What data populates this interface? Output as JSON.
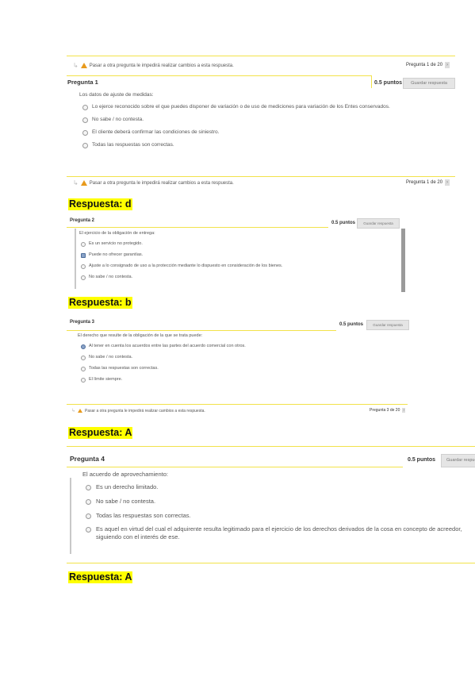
{
  "nav_notice": "Pasar a otra pregunta le impedirá realizar cambios a esta respuesta.",
  "save_label": "Guardar respuesta",
  "points_label": "0.5 puntos",
  "questions": [
    {
      "title": "Pregunta 1",
      "pager": "Pregunta 1 de 20",
      "text": "Los datos de ajuste de medidas:",
      "options": [
        "Lo ejerce reconocido sobre el que puedes disponer de variación o de uso de mediciones para variación de los Entes conservados.",
        "No sabe / no contesta.",
        "El cliente deberá confirmar las condiciones de siniestro.",
        "Todas las respuestas son correctas."
      ],
      "selected": -1,
      "answer": "Respuesta: d"
    },
    {
      "title": "Pregunta 2",
      "text": "El ejercicio de la obligación de entrega:",
      "options": [
        "Es un servicio no protegido.",
        "Puede no ofrecer garantías.",
        "Ajuste a lo consignado de uso a la protección mediante lo dispuesto en consideración de los bienes.",
        "No sabe / no contesta."
      ],
      "selected": 1,
      "answer": "Respuesta: b"
    },
    {
      "title": "Pregunta 3",
      "pager": "Pregunta 3 de 20",
      "text": "El derecho que resulte de la obligación de la que se trata puede:",
      "options": [
        "Al tener en cuenta los acuerdos entre las partes del acuerdo comercial con otros.",
        "No sabe / no contesta.",
        "Todas las respuestas son correctas.",
        "El límite siempre."
      ],
      "selected": 0,
      "answer": "Respuesta: A"
    },
    {
      "title": "Pregunta 4",
      "text": "El acuerdo de aprovechamiento:",
      "options": [
        "Es un derecho limitado.",
        "No sabe / no contesta.",
        "Todas las respuestas son correctas.",
        "Es aquel en virtud del cual el adquirente resulta legitimado para el ejercicio de los derechos derivados de la cosa en concepto de acreedor, siguiendo con el interés de ese."
      ],
      "selected": -1,
      "answer": "Respuesta: A"
    }
  ]
}
